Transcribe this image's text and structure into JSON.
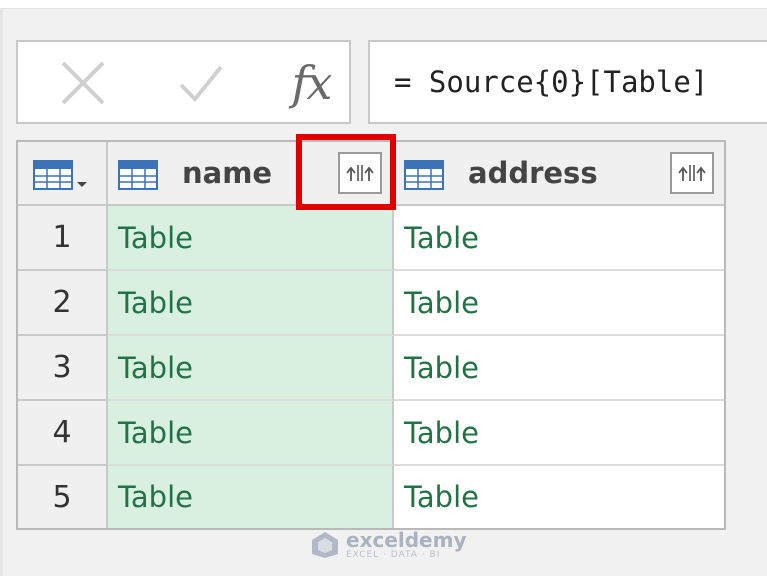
{
  "formula_bar": {
    "cancel_icon": "close-icon",
    "enter_icon": "check-icon",
    "fx_label": "fx",
    "formula": "= Source{0}[Table]"
  },
  "grid": {
    "corner_icon": "table-menu-icon",
    "columns": [
      {
        "name": "name",
        "icon": "table-icon",
        "expand_icon": "expand-column-icon"
      },
      {
        "name": "address",
        "icon": "table-icon",
        "expand_icon": "expand-column-icon"
      }
    ],
    "rows": [
      {
        "num": "1",
        "name": "Table",
        "address": "Table"
      },
      {
        "num": "2",
        "name": "Table",
        "address": "Table"
      },
      {
        "num": "3",
        "name": "Table",
        "address": "Table"
      },
      {
        "num": "4",
        "name": "Table",
        "address": "Table"
      },
      {
        "num": "5",
        "name": "Table",
        "address": "Table"
      }
    ]
  },
  "colors": {
    "selected_column_bg": "#d9f0e0",
    "cell_text": "#217346",
    "highlight_border": "#e00000"
  },
  "watermark": {
    "name": "exceldemy",
    "tagline": "EXCEL · DATA · BI"
  }
}
